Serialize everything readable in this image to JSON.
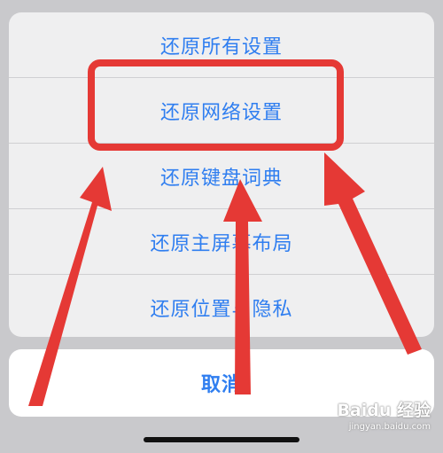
{
  "action_sheet": {
    "options": [
      {
        "label": "还原所有设置"
      },
      {
        "label": "还原网络设置"
      },
      {
        "label": "还原键盘词典"
      },
      {
        "label": "还原主屏幕布局"
      },
      {
        "label": "还原位置与隐私"
      }
    ],
    "highlighted_option": "还原网络设置",
    "cancel_label": "取消"
  },
  "watermark": {
    "brand": "Baidu 经验",
    "url": "jingyan.baidu.com"
  },
  "colors": {
    "accent": "#2f7ef0",
    "annotation": "#e53935",
    "sheet_background": "#efeff0",
    "cancel_background": "#ffffff",
    "backdrop": "#c9c9cc"
  },
  "annotations": {
    "highlight_box": "red-rectangle",
    "arrow_count": 3
  }
}
